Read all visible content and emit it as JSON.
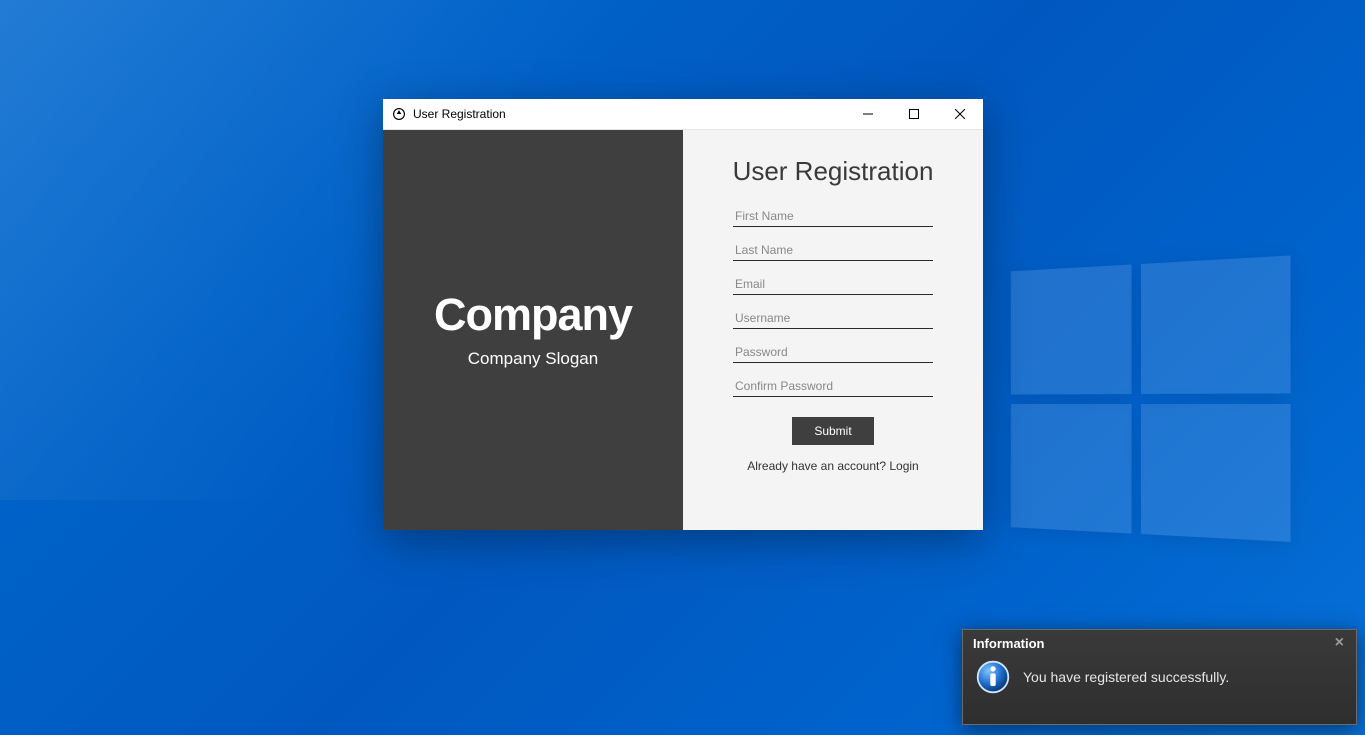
{
  "window": {
    "title": "User Registration"
  },
  "brand": {
    "name": "Company",
    "slogan": "Company Slogan"
  },
  "form": {
    "title": "User Registration",
    "first_name_placeholder": "First Name",
    "last_name_placeholder": "Last Name",
    "email_placeholder": "Email",
    "username_placeholder": "Username",
    "password_placeholder": "Password",
    "confirm_password_placeholder": "Confirm Password",
    "submit_label": "Submit",
    "login_link_text": "Already have an account? Login"
  },
  "toast": {
    "title": "Information",
    "message": "You have registered successfully."
  }
}
